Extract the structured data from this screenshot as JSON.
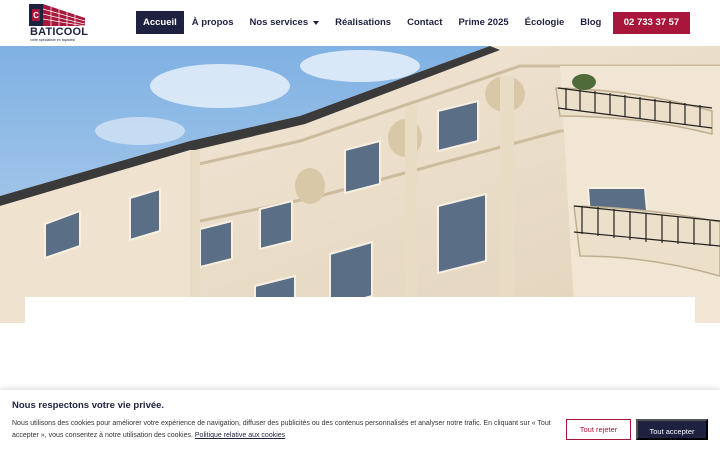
{
  "brand": {
    "name": "BATICOOL",
    "tagline": "votre spécialiste en façades!"
  },
  "nav": {
    "items": [
      {
        "label": "Accueil",
        "active": true
      },
      {
        "label": "À propos"
      },
      {
        "label": "Nos services",
        "has_dropdown": true
      },
      {
        "label": "Réalisations"
      },
      {
        "label": "Contact"
      },
      {
        "label": "Prime 2025"
      },
      {
        "label": "Écologie"
      },
      {
        "label": "Blog"
      }
    ],
    "phone": "02 733 37 57"
  },
  "cookie_banner": {
    "title": "Nous respectons votre vie privée.",
    "text": "Nous utilisons des cookies pour améliorer votre expérience de navigation, diffuser des publicités ou des contenus personnalisés et analyser notre trafic. En cliquant sur « Tout accepter », vous consentez à notre utilisation des cookies.",
    "policy_link": "Politique relative aux cookies",
    "reject_label": "Tout rejeter",
    "accept_label": "Tout accepter"
  },
  "colors": {
    "navy": "#1f2140",
    "accent": "#a8163b"
  }
}
